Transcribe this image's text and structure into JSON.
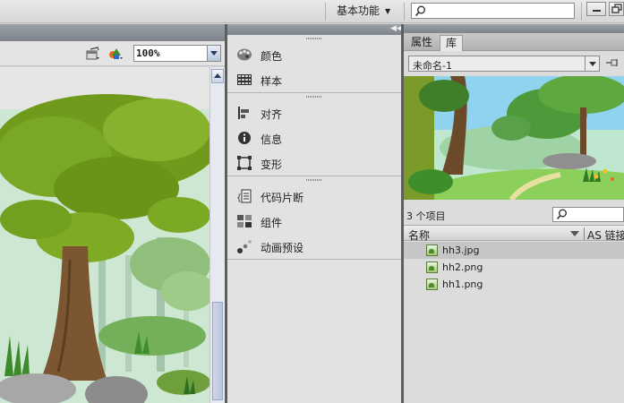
{
  "topbar": {
    "workspace_label": "基本功能",
    "search_value": ""
  },
  "stage": {
    "zoom": "100%"
  },
  "panels": {
    "group1": [
      {
        "label": "颜色",
        "icon": "color-palette-icon"
      },
      {
        "label": "样本",
        "icon": "swatches-icon"
      }
    ],
    "group2": [
      {
        "label": "对齐",
        "icon": "align-icon"
      },
      {
        "label": "信息",
        "icon": "info-icon"
      },
      {
        "label": "变形",
        "icon": "transform-icon"
      }
    ],
    "group3": [
      {
        "label": "代码片断",
        "icon": "code-snippets-icon"
      },
      {
        "label": "组件",
        "icon": "components-icon"
      },
      {
        "label": "动画预设",
        "icon": "motion-presets-icon"
      }
    ]
  },
  "library": {
    "tabs": [
      "属性",
      "库"
    ],
    "active_tab": "库",
    "document": "未命名-1",
    "item_count": "3 个项目",
    "columns": {
      "name": "名称",
      "linkage": "AS 链接"
    },
    "files": [
      {
        "name": "hh3.jpg",
        "selected": true
      },
      {
        "name": "hh2.png",
        "selected": false
      },
      {
        "name": "hh1.png",
        "selected": false
      }
    ]
  }
}
